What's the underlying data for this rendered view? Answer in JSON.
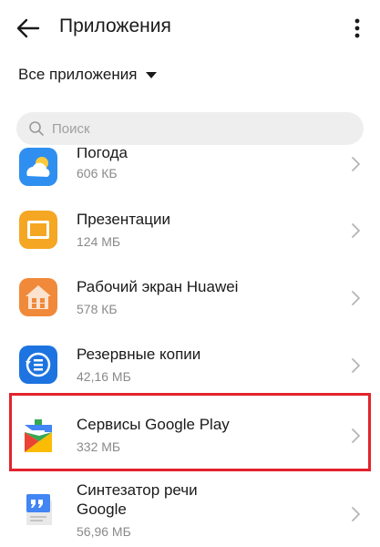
{
  "header": {
    "title": "Приложения"
  },
  "filter": {
    "label": "Все приложения"
  },
  "search": {
    "placeholder": "Поиск"
  },
  "apps": [
    {
      "name": "Погода",
      "size": "606 КБ",
      "icon": "weather-icon"
    },
    {
      "name": "Презентации",
      "size": "124 МБ",
      "icon": "presentations-icon"
    },
    {
      "name": "Рабочий экран Huawei",
      "size": "578 КБ",
      "icon": "home-launcher-icon"
    },
    {
      "name": "Резервные копии",
      "size": "42,16 МБ",
      "icon": "backup-icon"
    },
    {
      "name": "Сервисы Google Play",
      "size": "332 МБ",
      "icon": "google-play-services-icon",
      "highlighted": true
    },
    {
      "name_line1": "Синтезатор речи",
      "name_line2": "Google",
      "size": "56,96 МБ",
      "icon": "text-to-speech-icon"
    }
  ],
  "colors": {
    "highlight_border": "#e3232c",
    "search_bg": "#eeeeee",
    "secondary_text": "#8a8a8a"
  }
}
